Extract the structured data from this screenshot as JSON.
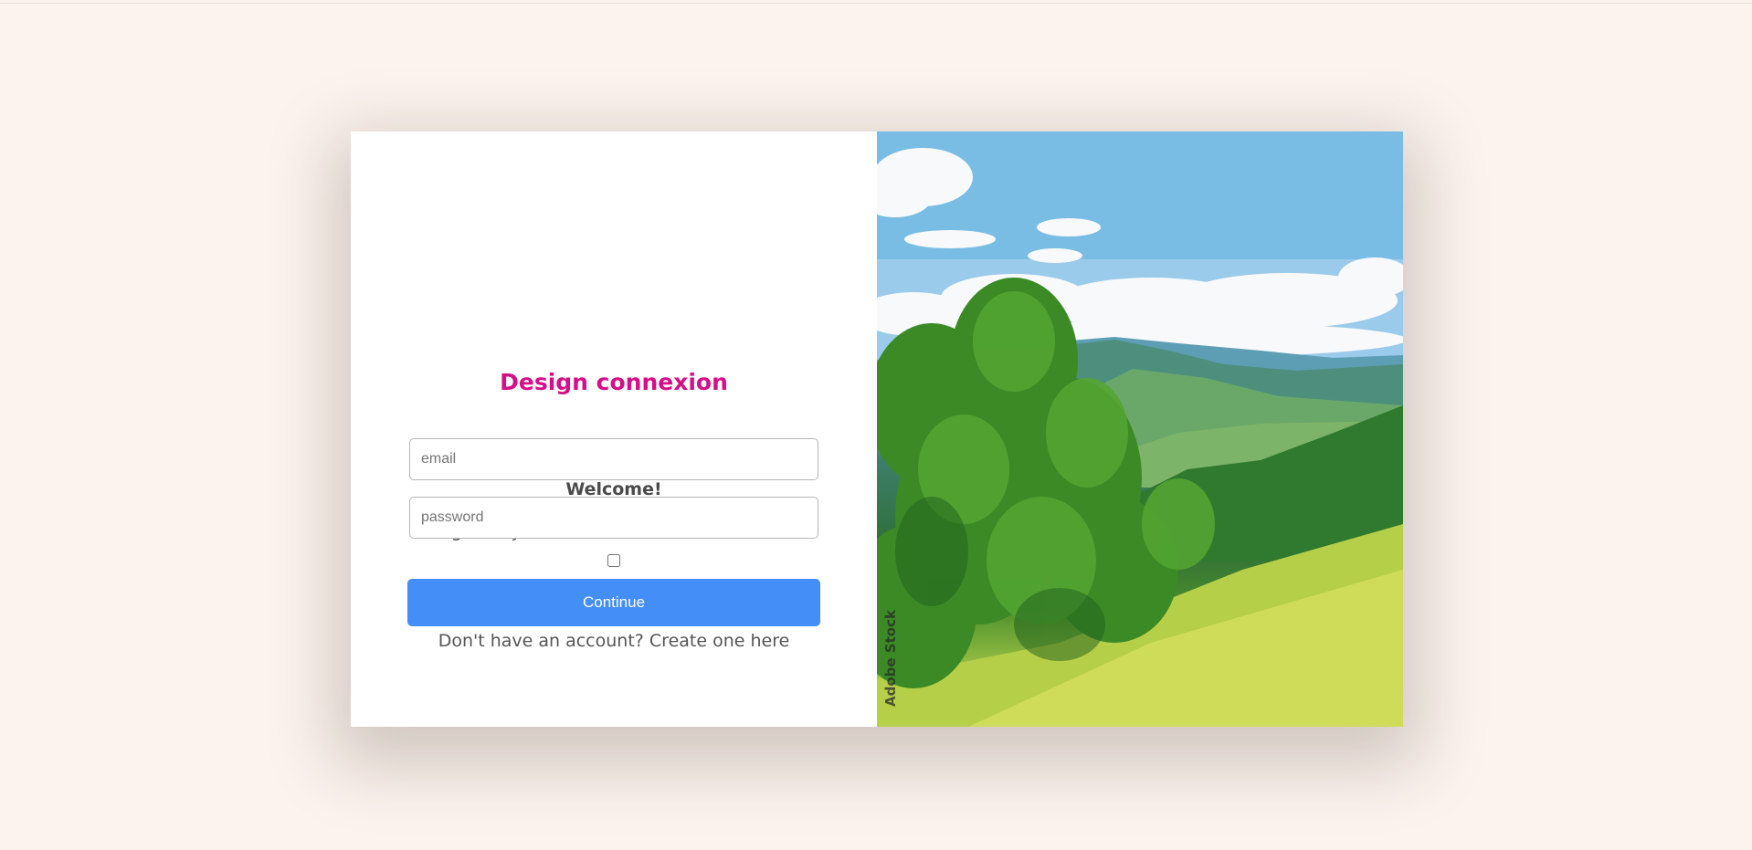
{
  "login": {
    "brand_title": "Design connexion",
    "welcome": "Welcome!",
    "subtitle": "Sign in by enterrin the information below",
    "email_placeholder": "email",
    "password_placeholder": "password",
    "continue_label": "Continue",
    "signup_text": "Don't have an account? Create one here"
  },
  "image": {
    "watermark": "Adobe Stock"
  },
  "colors": {
    "page_background": "#fcf3ee",
    "brand": "#d60f88",
    "button": "#448ef7"
  }
}
